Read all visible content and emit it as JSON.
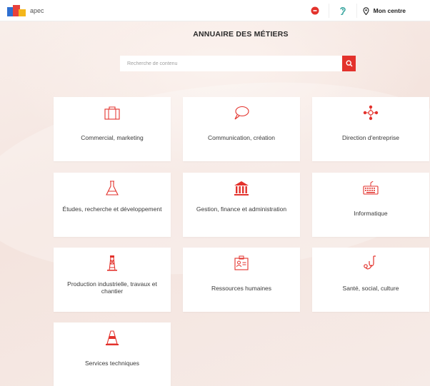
{
  "header": {
    "logo_text": "apec",
    "mon_centre": "Mon centre"
  },
  "page": {
    "title": "ANNUAIRE DES MÉTIERS"
  },
  "search": {
    "placeholder": "Recherche de contenu"
  },
  "colors": {
    "accent": "#e3322c",
    "icon_stroke": "#e3322c",
    "background": "#f6ece8"
  },
  "categories": [
    {
      "label": "Commercial, marketing",
      "icon": "briefcase-icon"
    },
    {
      "label": "Communication, création",
      "icon": "speech-bubble-icon"
    },
    {
      "label": "Direction d'entreprise",
      "icon": "people-network-icon"
    },
    {
      "label": "Études, recherche et développement",
      "icon": "flask-icon"
    },
    {
      "label": "Gestion, finance et administration",
      "icon": "bank-icon"
    },
    {
      "label": "Informatique",
      "icon": "keyboard-icon"
    },
    {
      "label": "Production industrielle, travaux et chantier",
      "icon": "oil-derrick-icon"
    },
    {
      "label": "Ressources humaines",
      "icon": "id-card-icon"
    },
    {
      "label": "Santé, social, culture",
      "icon": "stethoscope-icon"
    },
    {
      "label": "Services techniques",
      "icon": "cone-icon"
    }
  ]
}
